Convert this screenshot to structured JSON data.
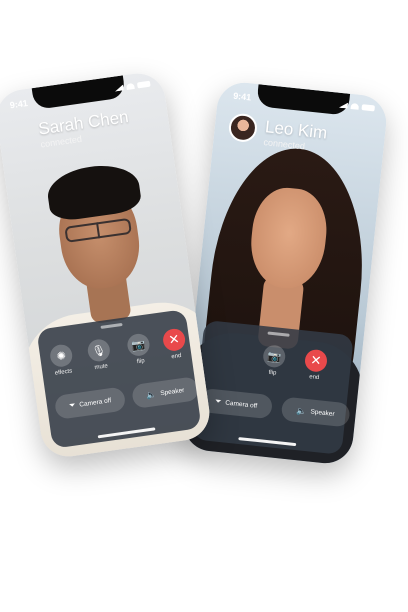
{
  "back_phone": {
    "time": "9:41",
    "caller_name": "Leo Kim",
    "caller_status": "connected",
    "controls": [
      {
        "label": "flip",
        "icon": "camera-icon"
      },
      {
        "label": "end",
        "icon": "close-icon"
      }
    ],
    "pills": {
      "camera_off": "Camera off",
      "speaker": "Speaker"
    }
  },
  "front_phone": {
    "time": "9:41",
    "caller_name": "Sarah Chen",
    "caller_status": "connected",
    "controls": [
      {
        "label": "effects",
        "icon": "sparkle-icon"
      },
      {
        "label": "mute",
        "icon": "mic-off-icon"
      },
      {
        "label": "flip",
        "icon": "camera-icon"
      },
      {
        "label": "end",
        "icon": "close-icon"
      }
    ],
    "pills": {
      "camera_off": "Camera off",
      "speaker": "Speaker"
    }
  },
  "colors": {
    "end_button": "#e9494b",
    "panel": "#323a46"
  }
}
